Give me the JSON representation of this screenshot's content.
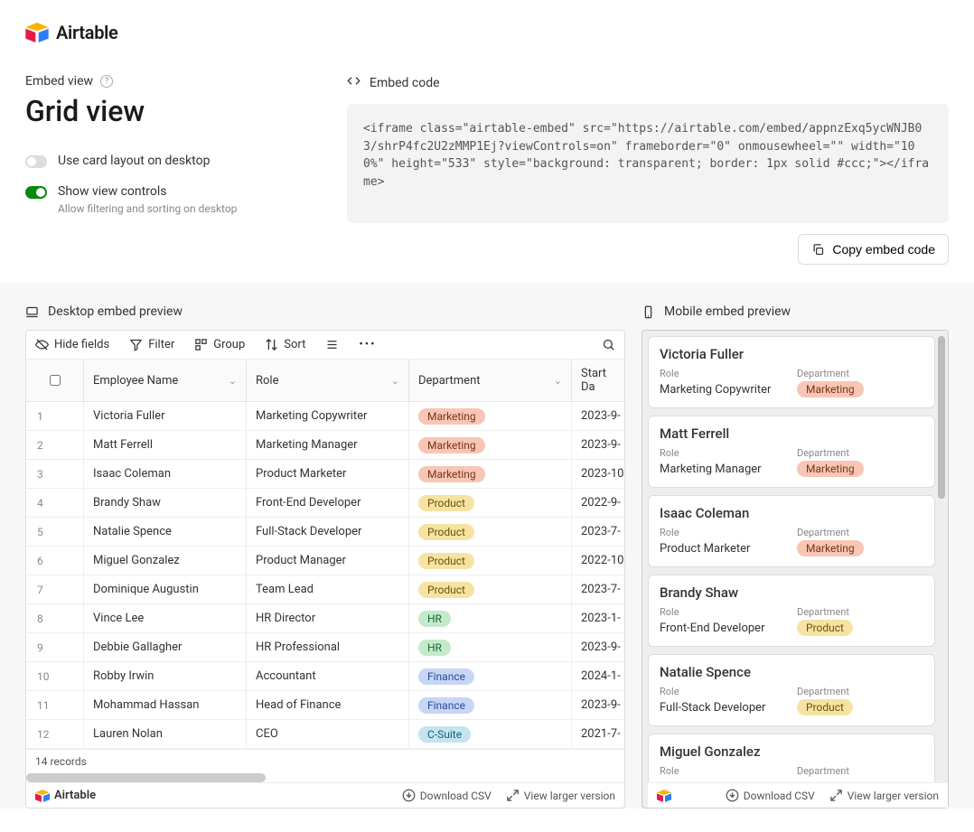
{
  "brand": "Airtable",
  "breadcrumb": "Embed view",
  "title": "Grid view",
  "toggles": {
    "card_layout": {
      "label": "Use card layout on desktop",
      "on": false
    },
    "view_controls": {
      "label": "Show view controls",
      "sub": "Allow filtering and sorting on desktop",
      "on": true
    }
  },
  "embed_code_label": "Embed code",
  "embed_code": "<iframe class=\"airtable-embed\" src=\"https://airtable.com/embed/appnzExq5ycWNJB03/shrP4fc2U2zMMP1Ej?viewControls=on\" frameborder=\"0\" onmousewheel=\"\" width=\"100%\" height=\"533\" style=\"background: transparent; border: 1px solid #ccc;\"></iframe>",
  "copy_btn": "Copy embed code",
  "desktop_label": "Desktop embed preview",
  "mobile_label": "Mobile embed preview",
  "toolbar": {
    "hide_fields": "Hide fields",
    "filter": "Filter",
    "group": "Group",
    "sort": "Sort"
  },
  "columns": {
    "name": "Employee Name",
    "role": "Role",
    "dept": "Department",
    "date": "Start Da"
  },
  "rows": [
    {
      "n": "1",
      "name": "Victoria Fuller",
      "role": "Marketing Copywriter",
      "dept": "Marketing",
      "date": "2023-9-"
    },
    {
      "n": "2",
      "name": "Matt Ferrell",
      "role": "Marketing Manager",
      "dept": "Marketing",
      "date": "2023-9-"
    },
    {
      "n": "3",
      "name": "Isaac Coleman",
      "role": "Product Marketer",
      "dept": "Marketing",
      "date": "2023-10"
    },
    {
      "n": "4",
      "name": "Brandy Shaw",
      "role": "Front-End Developer",
      "dept": "Product",
      "date": "2022-9-"
    },
    {
      "n": "5",
      "name": "Natalie Spence",
      "role": "Full-Stack Developer",
      "dept": "Product",
      "date": "2023-7-"
    },
    {
      "n": "6",
      "name": "Miguel Gonzalez",
      "role": "Product Manager",
      "dept": "Product",
      "date": "2022-10"
    },
    {
      "n": "7",
      "name": "Dominique Augustin",
      "role": "Team Lead",
      "dept": "Product",
      "date": "2023-7-"
    },
    {
      "n": "8",
      "name": "Vince Lee",
      "role": "HR Director",
      "dept": "HR",
      "date": "2023-1-"
    },
    {
      "n": "9",
      "name": "Debbie Gallagher",
      "role": "HR Professional",
      "dept": "HR",
      "date": "2023-9-"
    },
    {
      "n": "10",
      "name": "Robby Irwin",
      "role": "Accountant",
      "dept": "Finance",
      "date": "2024-1-"
    },
    {
      "n": "11",
      "name": "Mohammad Hassan",
      "role": "Head of Finance",
      "dept": "Finance",
      "date": "2023-9-"
    },
    {
      "n": "12",
      "name": "Lauren Nolan",
      "role": "CEO",
      "dept": "C-Suite",
      "date": "2021-7-"
    }
  ],
  "record_count": "14 records",
  "footer": {
    "download": "Download CSV",
    "larger": "View larger version"
  },
  "card_labels": {
    "role": "Role",
    "dept": "Department"
  },
  "cards": [
    {
      "name": "Victoria Fuller",
      "role": "Marketing Copywriter",
      "dept": "Marketing"
    },
    {
      "name": "Matt Ferrell",
      "role": "Marketing Manager",
      "dept": "Marketing"
    },
    {
      "name": "Isaac Coleman",
      "role": "Product Marketer",
      "dept": "Marketing"
    },
    {
      "name": "Brandy Shaw",
      "role": "Front-End Developer",
      "dept": "Product"
    },
    {
      "name": "Natalie Spence",
      "role": "Full-Stack Developer",
      "dept": "Product"
    },
    {
      "name": "Miguel Gonzalez",
      "role": "",
      "dept": ""
    }
  ],
  "dept_colors": {
    "Marketing": "pill-marketing",
    "Product": "pill-product",
    "HR": "pill-hr",
    "Finance": "pill-finance",
    "C-Suite": "pill-csuite"
  }
}
